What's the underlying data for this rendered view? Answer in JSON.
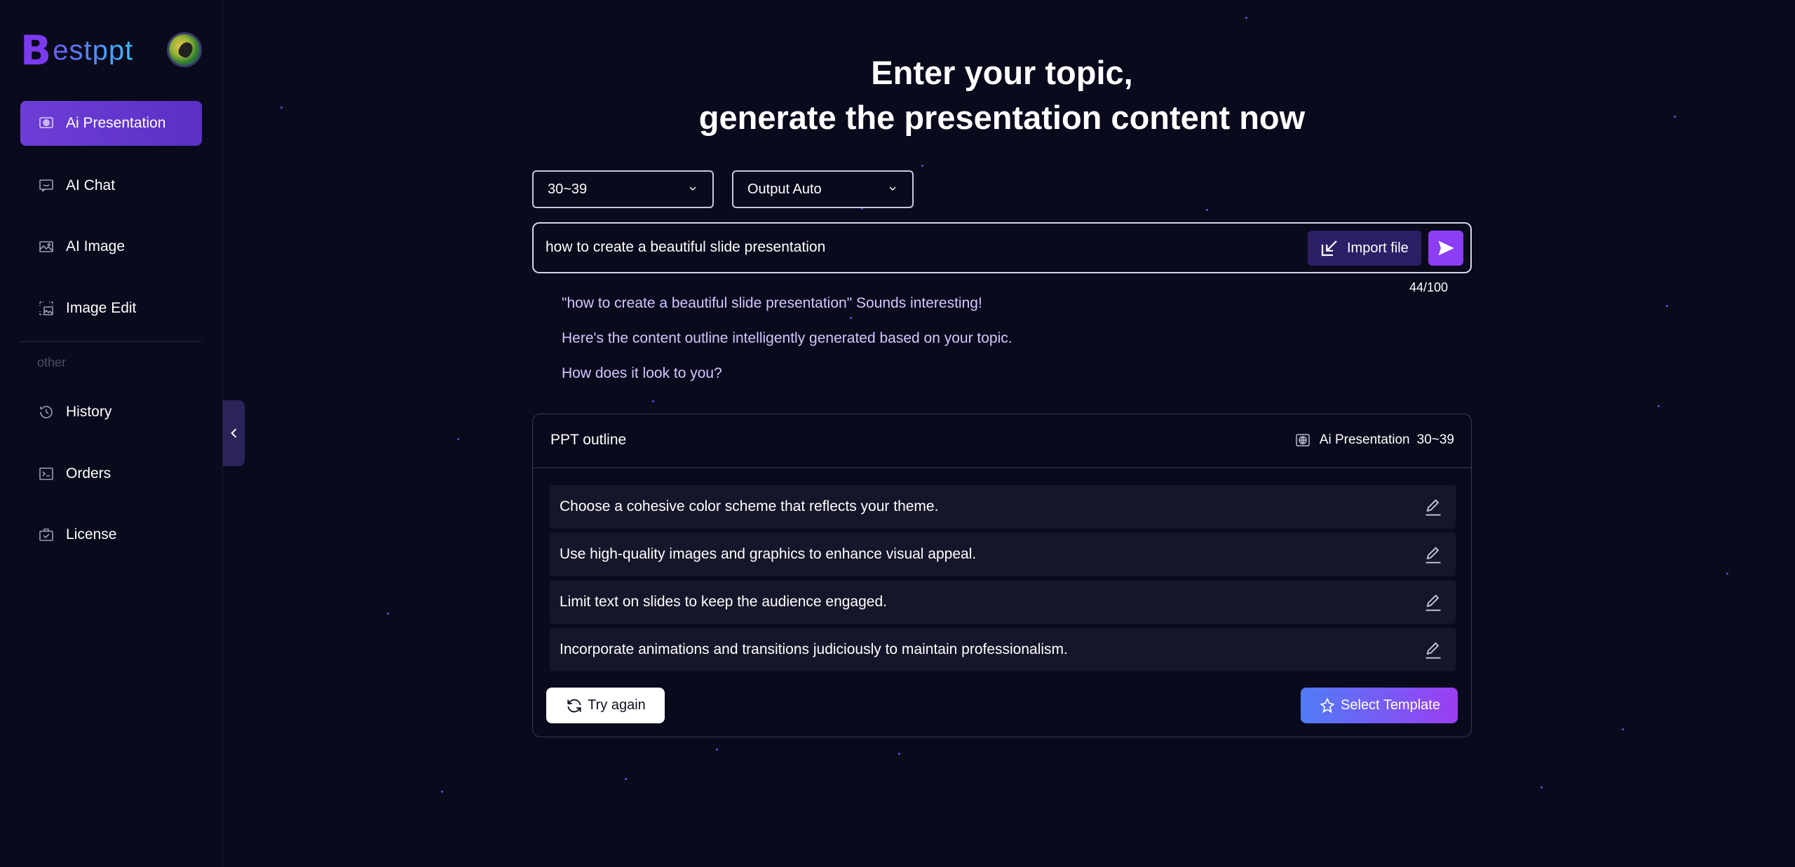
{
  "brand": {
    "logo_letter": "B",
    "logo_text": "estppt"
  },
  "sidebar": {
    "items": [
      {
        "label": "Ai Presentation",
        "icon": "presentation-globe-icon",
        "active": true
      },
      {
        "label": "AI Chat",
        "icon": "chat-icon",
        "active": false
      },
      {
        "label": "AI Image",
        "icon": "image-icon",
        "active": false
      },
      {
        "label": "Image Edit",
        "icon": "image-edit-icon",
        "active": false
      }
    ],
    "section_label": "other",
    "other_items": [
      {
        "label": "History",
        "icon": "history-icon"
      },
      {
        "label": "Orders",
        "icon": "terminal-icon"
      },
      {
        "label": "License",
        "icon": "license-icon"
      }
    ]
  },
  "main": {
    "headline_line1": "Enter your topic,",
    "headline_line2": "generate the presentation content now",
    "page_count_select": "30~39",
    "output_select": "Output Auto",
    "topic_value": "how to create a beautiful slide presentation",
    "import_label": "Import file",
    "char_counter": "44/100",
    "ai_messages": [
      "\"how to create a beautiful slide presentation\" Sounds interesting!",
      "Here's the content outline intelligently generated based on your topic.",
      "How does it look to you?"
    ]
  },
  "outline": {
    "title": "PPT outline",
    "meta_label": "Ai Presentation",
    "meta_pages": "30~39",
    "items": [
      "Choose a cohesive color scheme that reflects your theme.",
      "Use high-quality images and graphics to enhance visual appeal.",
      "Limit text on slides to keep the audience engaged.",
      "Incorporate animations and transitions judiciously to maintain professionalism."
    ],
    "try_again_label": "Try again",
    "select_template_label": "Select Template"
  },
  "colors": {
    "background": "#0a0a1d",
    "accent_purple": "#8b3ef3",
    "active_nav": "#6d3ed6",
    "template_gradient_start": "#4f7cf5",
    "template_gradient_end": "#9b3ef2"
  }
}
